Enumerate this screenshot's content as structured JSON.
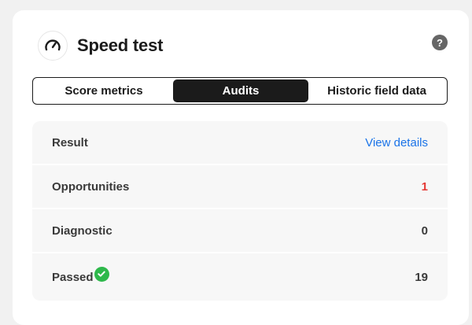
{
  "card": {
    "title": "Speed test",
    "help_glyph": "?"
  },
  "tabs": [
    {
      "label": "Score metrics"
    },
    {
      "label": "Audits",
      "selected": true
    },
    {
      "label": "Historic field data"
    }
  ],
  "rows": [
    {
      "label": "Result",
      "value": "View details"
    },
    {
      "label": "Opportunities",
      "value": "1"
    },
    {
      "label": "Diagnostic",
      "value": "0"
    },
    {
      "label": "Passed",
      "value": "19"
    }
  ],
  "colors": {
    "selected_tab_bg": "#1b1b1b",
    "link": "#1a73e8",
    "opportunities": "#e53935",
    "passed_check": "#2eb84b"
  },
  "icons": {
    "header": "speedometer-icon",
    "help": "question-mark-icon",
    "passed": "check-circle-icon"
  }
}
